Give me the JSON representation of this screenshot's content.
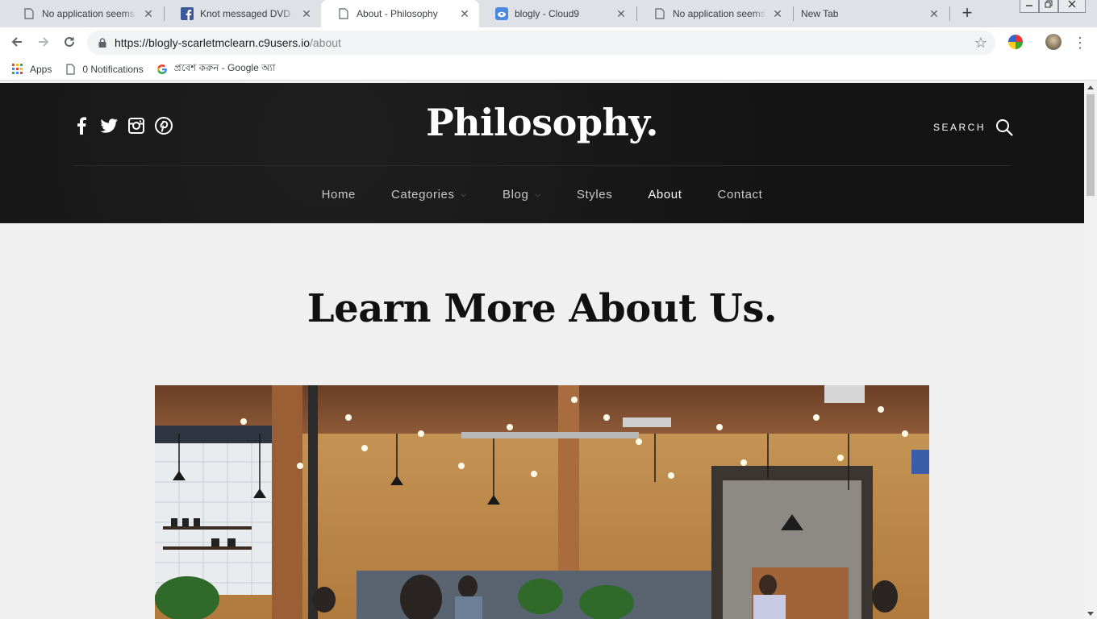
{
  "browser": {
    "tabs": [
      {
        "title": "No application seems to be",
        "icon": "document-icon"
      },
      {
        "title": "Knot messaged DVD - Web",
        "icon": "facebook-icon"
      },
      {
        "title": "About - Philosophy",
        "icon": "document-icon",
        "active": true
      },
      {
        "title": "blogly - Cloud9",
        "icon": "cloud9-icon"
      },
      {
        "title": "No application seems to be",
        "icon": "document-icon"
      },
      {
        "title": "New Tab",
        "icon": ""
      }
    ],
    "close_glyph": "✕",
    "new_tab_glyph": "+",
    "url_host": "https://blogly-scarletmclearn.c9users.io",
    "url_path": "/about",
    "bookmarks": [
      {
        "label": "Apps",
        "icon": "apps-grid-icon"
      },
      {
        "label": "0 Notifications",
        "icon": "document-icon"
      },
      {
        "label": "প্রবেশ করুন - Google অ্যা",
        "icon": "google-icon"
      }
    ]
  },
  "site": {
    "logo": "Philosophy.",
    "search_label": "SEARCH",
    "social": [
      "facebook-icon",
      "twitter-icon",
      "instagram-icon",
      "pinterest-icon"
    ],
    "nav": [
      {
        "label": "Home",
        "dropdown": false,
        "active": false
      },
      {
        "label": "Categories",
        "dropdown": true,
        "active": false
      },
      {
        "label": "Blog",
        "dropdown": true,
        "active": false
      },
      {
        "label": "Styles",
        "dropdown": false,
        "active": false
      },
      {
        "label": "About",
        "dropdown": false,
        "active": true
      },
      {
        "label": "Contact",
        "dropdown": false,
        "active": false
      }
    ],
    "page_title": "Learn More About Us."
  },
  "colors": {
    "header_bg": "#151515",
    "page_bg": "#f0f0f0",
    "title_text": "#111111"
  }
}
